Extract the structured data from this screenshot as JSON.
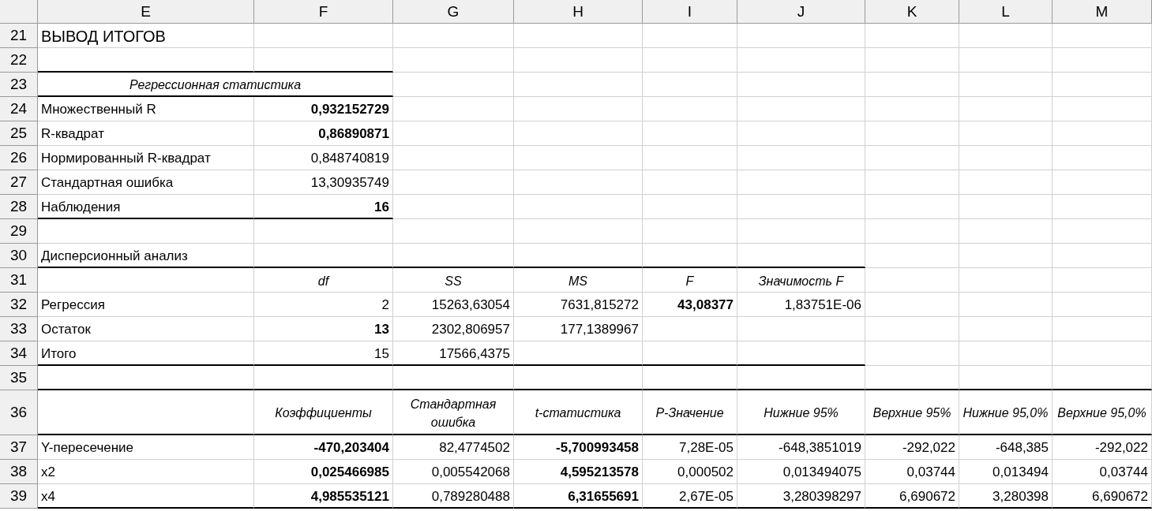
{
  "columns": [
    "E",
    "F",
    "G",
    "H",
    "I",
    "J",
    "K",
    "L",
    "M"
  ],
  "rows": [
    {
      "number": "21",
      "kind": "title",
      "cells": [
        {
          "text": "ВЫВОД ИТОГОВ",
          "bold": false
        },
        null,
        null,
        null,
        null,
        null,
        null,
        null,
        null
      ]
    },
    {
      "number": "22",
      "kind": "data",
      "rule": [
        true,
        true,
        false,
        false,
        false,
        false,
        false,
        false,
        false
      ],
      "cells": [
        null,
        null,
        null,
        null,
        null,
        null,
        null,
        null,
        null
      ]
    },
    {
      "number": "23",
      "kind": "header",
      "rule": [
        true,
        true,
        false,
        false,
        false,
        false,
        false,
        false,
        false
      ],
      "cells": [
        {
          "text": "Регрессионная статистика",
          "bold": false,
          "span": true
        },
        null,
        null,
        null,
        null,
        null,
        null,
        null,
        null
      ]
    },
    {
      "number": "24",
      "kind": "data",
      "cells": [
        {
          "text": "Множественный R",
          "bold": false
        },
        {
          "text": "0,932152729",
          "bold": true
        },
        null,
        null,
        null,
        null,
        null,
        null,
        null
      ]
    },
    {
      "number": "25",
      "kind": "data",
      "cells": [
        {
          "text": "R-квадрат",
          "bold": false
        },
        {
          "text": "0,86890871",
          "bold": true
        },
        null,
        null,
        null,
        null,
        null,
        null,
        null
      ]
    },
    {
      "number": "26",
      "kind": "data",
      "cells": [
        {
          "text": "Нормированный R-квадрат",
          "bold": false
        },
        {
          "text": "0,848740819",
          "bold": false
        },
        null,
        null,
        null,
        null,
        null,
        null,
        null
      ]
    },
    {
      "number": "27",
      "kind": "data",
      "cells": [
        {
          "text": "Стандартная ошибка",
          "bold": false
        },
        {
          "text": "13,30935749",
          "bold": false
        },
        null,
        null,
        null,
        null,
        null,
        null,
        null
      ]
    },
    {
      "number": "28",
      "kind": "data",
      "rule": [
        true,
        true,
        false,
        false,
        false,
        false,
        false,
        false,
        false
      ],
      "cells": [
        {
          "text": "Наблюдения",
          "bold": false
        },
        {
          "text": "16",
          "bold": true
        },
        null,
        null,
        null,
        null,
        null,
        null,
        null
      ]
    },
    {
      "number": "29",
      "kind": "data",
      "cells": [
        null,
        null,
        null,
        null,
        null,
        null,
        null,
        null,
        null
      ]
    },
    {
      "number": "30",
      "kind": "data",
      "rule": [
        true,
        true,
        true,
        true,
        true,
        true,
        false,
        false,
        false
      ],
      "cells": [
        {
          "text": "Дисперсионный анализ",
          "bold": false
        },
        null,
        null,
        null,
        null,
        null,
        null,
        null,
        null
      ]
    },
    {
      "number": "31",
      "kind": "header",
      "cells": [
        null,
        {
          "text": "df",
          "bold": false
        },
        {
          "text": "SS",
          "bold": false
        },
        {
          "text": "MS",
          "bold": false
        },
        {
          "text": "F",
          "bold": false
        },
        {
          "text": "Значимость F",
          "bold": false
        },
        null,
        null,
        null
      ]
    },
    {
      "number": "32",
      "kind": "data",
      "cells": [
        {
          "text": "Регрессия",
          "bold": false
        },
        {
          "text": "2",
          "bold": false
        },
        {
          "text": "15263,63054",
          "bold": false
        },
        {
          "text": "7631,815272",
          "bold": false
        },
        {
          "text": "43,08377",
          "bold": true
        },
        {
          "text": "1,83751E-06",
          "bold": false
        },
        null,
        null,
        null
      ]
    },
    {
      "number": "33",
      "kind": "data",
      "cells": [
        {
          "text": "Остаток",
          "bold": false
        },
        {
          "text": "13",
          "bold": true
        },
        {
          "text": "2302,806957",
          "bold": false
        },
        {
          "text": "177,1389967",
          "bold": false
        },
        null,
        null,
        null,
        null,
        null
      ]
    },
    {
      "number": "34",
      "kind": "data",
      "rule": [
        true,
        true,
        true,
        true,
        true,
        true,
        false,
        false,
        false
      ],
      "cells": [
        {
          "text": "Итого",
          "bold": false
        },
        {
          "text": "15",
          "bold": false
        },
        {
          "text": "17566,4375",
          "bold": false
        },
        null,
        null,
        null,
        null,
        null,
        null
      ]
    },
    {
      "number": "35",
      "kind": "data",
      "rule": [
        true,
        true,
        true,
        true,
        true,
        true,
        true,
        true,
        true
      ],
      "cells": [
        null,
        null,
        null,
        null,
        null,
        null,
        null,
        null,
        null
      ]
    },
    {
      "number": "36",
      "kind": "header",
      "rule": [
        true,
        true,
        true,
        true,
        true,
        true,
        true,
        true,
        true
      ],
      "cells": [
        null,
        {
          "text": "Коэффициенты",
          "bold": false
        },
        {
          "text": "Стандартная ошибка",
          "bold": false
        },
        {
          "text": "t-статистика",
          "bold": false
        },
        {
          "text": "P-Значение",
          "bold": false
        },
        {
          "text": "Нижние 95%",
          "bold": false
        },
        {
          "text": "Верхние 95%",
          "bold": false
        },
        {
          "text": "Нижние 95,0%",
          "bold": false
        },
        {
          "text": "Верхние 95,0%",
          "bold": false
        }
      ]
    },
    {
      "number": "37",
      "kind": "data",
      "cells": [
        {
          "text": "Y-пересечение",
          "bold": false
        },
        {
          "text": "-470,203404",
          "bold": true
        },
        {
          "text": "82,4774502",
          "bold": false
        },
        {
          "text": "-5,700993458",
          "bold": true
        },
        {
          "text": "7,28E-05",
          "bold": false
        },
        {
          "text": "-648,3851019",
          "bold": false
        },
        {
          "text": "-292,022",
          "bold": false
        },
        {
          "text": "-648,385",
          "bold": false
        },
        {
          "text": "-292,022",
          "bold": false
        }
      ]
    },
    {
      "number": "38",
      "kind": "data",
      "cells": [
        {
          "text": "x2",
          "bold": false
        },
        {
          "text": "0,025466985",
          "bold": true
        },
        {
          "text": "0,005542068",
          "bold": false
        },
        {
          "text": "4,595213578",
          "bold": true
        },
        {
          "text": "0,000502",
          "bold": false
        },
        {
          "text": "0,013494075",
          "bold": false
        },
        {
          "text": "0,03744",
          "bold": false
        },
        {
          "text": "0,013494",
          "bold": false
        },
        {
          "text": "0,03744",
          "bold": false
        }
      ]
    },
    {
      "number": "39",
      "kind": "data",
      "rule": [
        true,
        true,
        true,
        true,
        true,
        true,
        true,
        true,
        true
      ],
      "cells": [
        {
          "text": "x4",
          "bold": false
        },
        {
          "text": "4,985535121",
          "bold": true
        },
        {
          "text": "0,789280488",
          "bold": false
        },
        {
          "text": "6,31655691",
          "bold": true
        },
        {
          "text": "2,67E-05",
          "bold": false
        },
        {
          "text": "3,280398297",
          "bold": false
        },
        {
          "text": "6,690672",
          "bold": false
        },
        {
          "text": "3,280398",
          "bold": false
        },
        {
          "text": "6,690672",
          "bold": false
        }
      ]
    }
  ]
}
